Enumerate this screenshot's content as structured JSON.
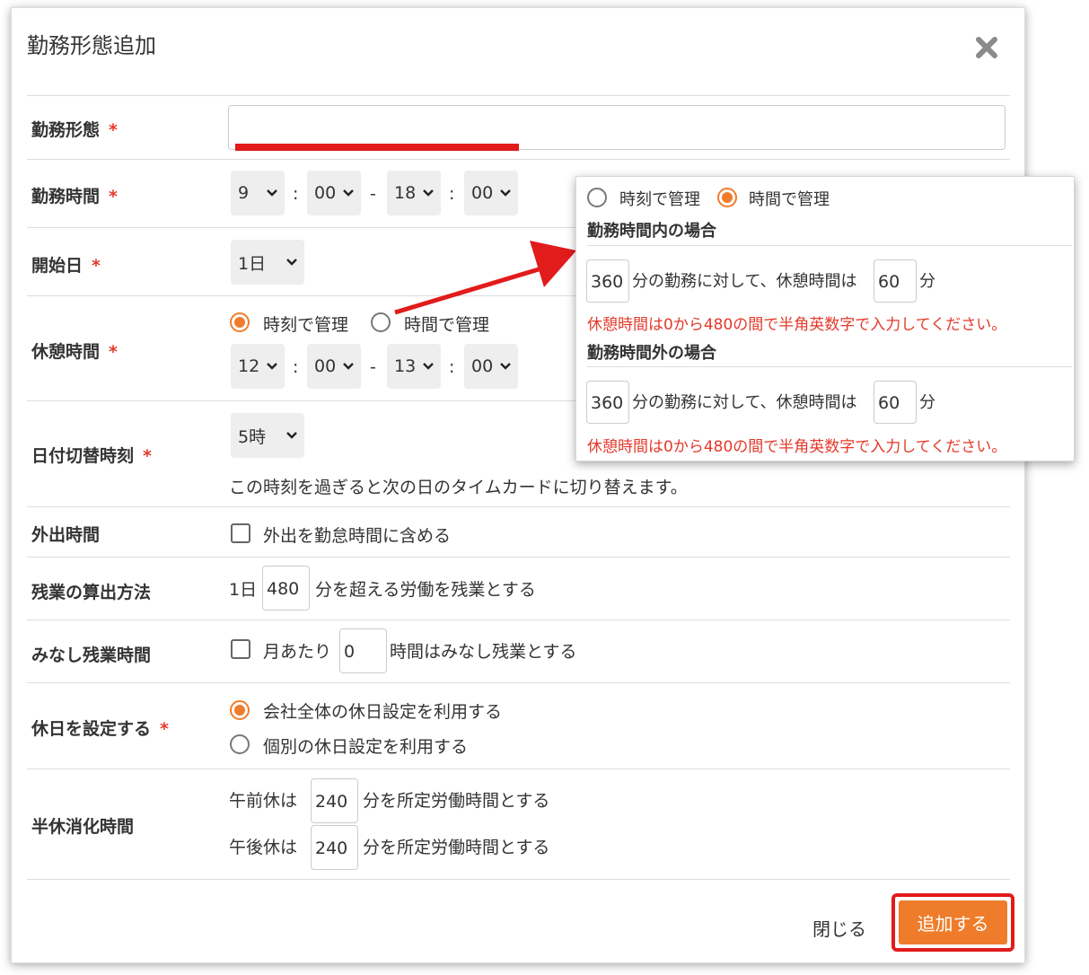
{
  "modal": {
    "title": "勤務形態追加"
  },
  "rows": {
    "work_type": {
      "label": "勤務形態",
      "required": "*"
    },
    "work_time": {
      "label": "勤務時間",
      "required": "*",
      "start_hour": "9",
      "start_min": "00",
      "end_hour": "18",
      "end_min": "00",
      "colon": ":",
      "dash": "-"
    },
    "start_day": {
      "label": "開始日",
      "required": "*",
      "value": "1日"
    },
    "break_time": {
      "label": "休憩時間",
      "required": "*",
      "option_clock": "時刻で管理",
      "option_duration": "時間で管理",
      "start_hour": "12",
      "start_min": "00",
      "end_hour": "13",
      "end_min": "00"
    },
    "day_switch": {
      "label": "日付切替時刻",
      "required": "*",
      "value": "5時",
      "note": "この時刻を過ぎると次の日のタイムカードに切り替えます。"
    },
    "outing": {
      "label": "外出時間",
      "checkbox_label": "外出を勤怠時間に含める"
    },
    "overtime": {
      "label": "残業の算出方法",
      "prefix": "1日",
      "value": "480",
      "suffix": "分を超える労働を残業とする"
    },
    "deemed_overtime": {
      "label": "みなし残業時間",
      "prefix": "月あたり",
      "value": "0",
      "suffix": "時間はみなし残業とする"
    },
    "holiday": {
      "label": "休日を設定する",
      "required": "*",
      "option_company": "会社全体の休日設定を利用する",
      "option_individual": "個別の休日設定を利用する"
    },
    "half_day": {
      "label": "半休消化時間",
      "am_prefix": "午前休は",
      "am_value": "240",
      "am_suffix": "分を所定労働時間とする",
      "pm_prefix": "午後休は",
      "pm_value": "240",
      "pm_suffix": "分を所定労働時間とする"
    }
  },
  "footer": {
    "close_label": "閉じる",
    "add_label": "追加する"
  },
  "popup": {
    "option_clock": "時刻で管理",
    "option_duration": "時間で管理",
    "within": {
      "title": "勤務時間内の場合",
      "work_min": "360",
      "mid_text": "分の勤務に対して、休憩時間は",
      "break_min": "60",
      "unit": "分",
      "error": "休憩時間は0から480の間で半角英数字で入力してください。"
    },
    "outside": {
      "title": "勤務時間外の場合",
      "work_min": "360",
      "mid_text": "分の勤務に対して、休憩時間は",
      "break_min": "60",
      "unit": "分",
      "error": "休憩時間は0から480の間で半角英数字で入力してください。"
    }
  },
  "colors": {
    "accent": "#ef7c2a",
    "error": "#e4392b",
    "highlight": "#e21b1b"
  }
}
